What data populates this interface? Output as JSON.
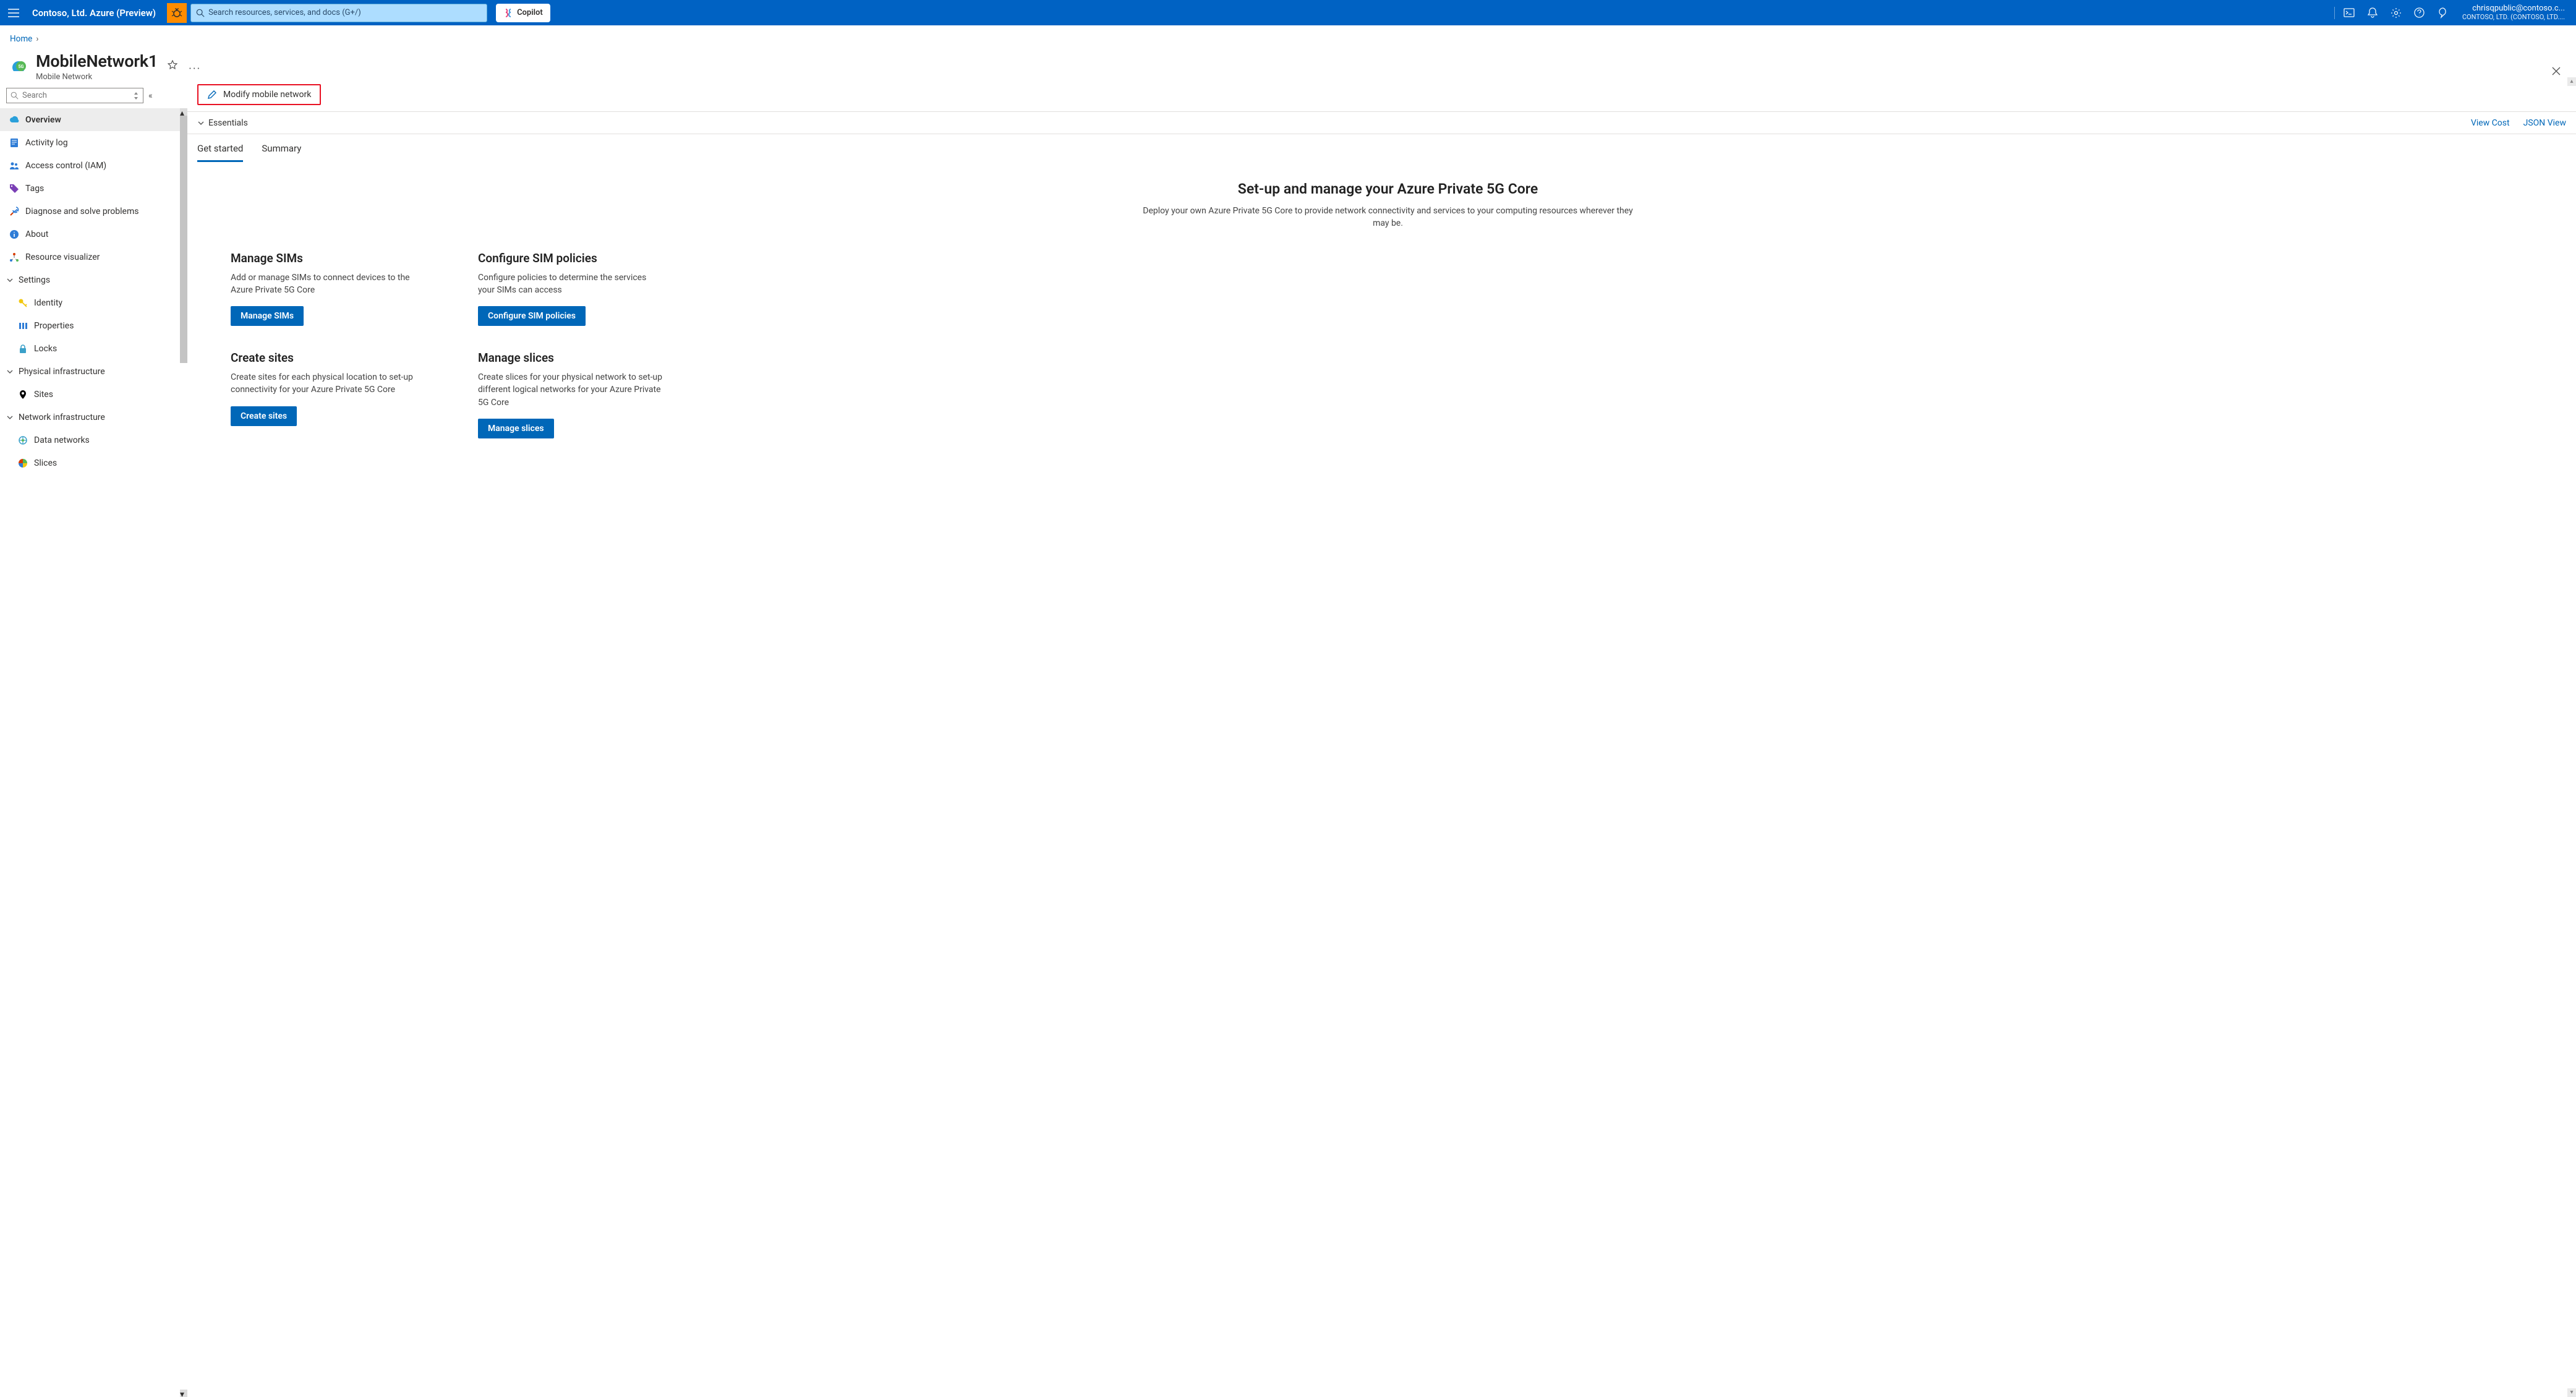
{
  "topbar": {
    "brand": "Contoso, Ltd. Azure (Preview)",
    "search_placeholder": "Search resources, services, and docs (G+/)",
    "copilot_label": "Copilot",
    "account": {
      "email": "chrisqpublic@contoso.c...",
      "tenant": "CONTOSO, LTD. (CONTOSO, LTD...."
    }
  },
  "breadcrumb": {
    "home": "Home"
  },
  "resource": {
    "title": "MobileNetwork1",
    "subtitle": "Mobile Network"
  },
  "sidebar": {
    "search_placeholder": "Search",
    "items": {
      "overview": "Overview",
      "activity": "Activity log",
      "access": "Access control (IAM)",
      "tags": "Tags",
      "diagnose": "Diagnose and solve problems",
      "about": "About",
      "visualizer": "Resource visualizer"
    },
    "groups": {
      "settings": {
        "label": "Settings",
        "identity": "Identity",
        "properties": "Properties",
        "locks": "Locks"
      },
      "physical": {
        "label": "Physical infrastructure",
        "sites": "Sites"
      },
      "network": {
        "label": "Network infrastructure",
        "datanetworks": "Data networks",
        "slices": "Slices"
      }
    }
  },
  "toolbar": {
    "modify": "Modify mobile network"
  },
  "essentials": {
    "label": "Essentials",
    "view_cost": "View Cost",
    "json_view": "JSON View"
  },
  "tabs": {
    "get_started": "Get started",
    "summary": "Summary"
  },
  "hero": {
    "title": "Set-up and manage your Azure Private 5G Core",
    "subtitle": "Deploy your own Azure Private 5G Core to provide network connectivity and services to your computing resources wherever they may be."
  },
  "cards": {
    "sims": {
      "title": "Manage SIMs",
      "desc": "Add or manage SIMs to connect devices to the Azure Private 5G Core",
      "cta": "Manage SIMs"
    },
    "pol": {
      "title": "Configure SIM policies",
      "desc": "Configure policies to determine the services your SIMs can access",
      "cta": "Configure SIM policies"
    },
    "sites": {
      "title": "Create sites",
      "desc": "Create sites for each physical location to set-up connectivity for your Azure Private 5G Core",
      "cta": "Create sites"
    },
    "slices": {
      "title": "Manage slices",
      "desc": "Create slices for your physical network to set-up different logical networks for your Azure Private 5G Core",
      "cta": "Manage slices"
    }
  }
}
